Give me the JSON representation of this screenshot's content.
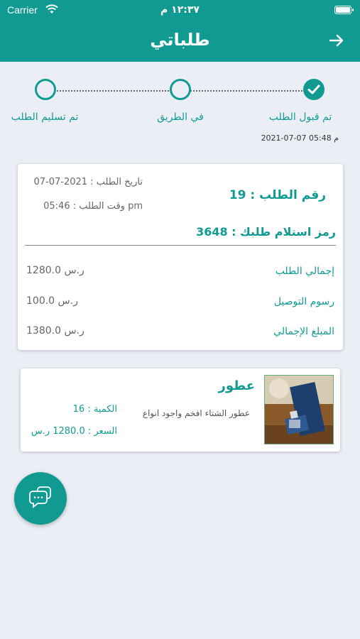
{
  "status_bar": {
    "carrier": "Carrier",
    "time": "١٢:٣٧ م"
  },
  "header": {
    "title": "طلباتي"
  },
  "tracker": {
    "steps": [
      {
        "label": "تم قبول الطلب",
        "state": "done"
      },
      {
        "label": "في الطريق",
        "state": "pending"
      },
      {
        "label": "تم تسليم الطلب",
        "state": "pending"
      }
    ],
    "accepted_time": "2021-07-07 05:48 م"
  },
  "order": {
    "number_label": "رقم الطلب : 19",
    "date_label": "تاريخ الطلب : 2021-07-07",
    "time_label": "وقت الطلب : 05:46 pm",
    "pickup_code_label": "رمز استلام طلبك : 3648",
    "rows": [
      {
        "label": "إجمالي الطلب",
        "value": "1280.0 ر.س"
      },
      {
        "label": "رسوم التوصيل",
        "value": "100.0 ر.س"
      },
      {
        "label": "المبلغ الإجمالي",
        "value": "1380.0 ر.س"
      }
    ]
  },
  "items": [
    {
      "name": "عطور",
      "description": "عطور الشتاء افخم واجود انواع",
      "quantity_label": "الكمية : 16",
      "price_label": "السعر : 1280.0 ر.س"
    }
  ],
  "colors": {
    "primary": "#119a92",
    "background": "#eceef6"
  },
  "icons": {
    "back": "arrow-right-icon",
    "chat": "chat-bubbles-icon",
    "check": "check-icon",
    "wifi": "wifi-icon",
    "battery": "battery-icon"
  }
}
